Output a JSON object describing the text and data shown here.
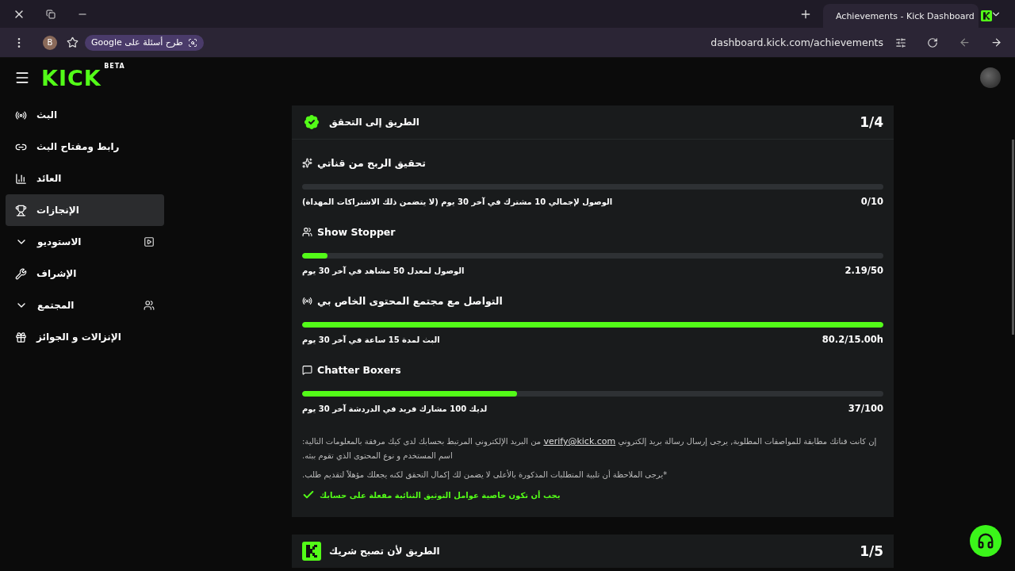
{
  "browser": {
    "tabs": [
      {
        "title": "Achievements - Kick Dashboard",
        "selected": true
      }
    ],
    "profile": "B",
    "search_chip": "طرح أسئلة على Google",
    "address": "dashboard.kick.com/achievements"
  },
  "header": {
    "logo": "KICK",
    "badge": "BETA"
  },
  "sidebar": {
    "items": [
      {
        "label": "البث",
        "kind": "link",
        "selected": false
      },
      {
        "label": "رابط ومفتاح البث",
        "kind": "link",
        "selected": false
      },
      {
        "label": "العائد",
        "kind": "link",
        "selected": false
      },
      {
        "label": "الإنجازات",
        "kind": "link",
        "selected": true
      },
      {
        "label": "الاستوديو",
        "kind": "group",
        "selected": false,
        "expanded": false
      },
      {
        "label": "الإشراف",
        "kind": "link",
        "selected": false
      },
      {
        "label": "المجتمع",
        "kind": "group",
        "selected": false,
        "expanded": false
      },
      {
        "label": "الإنزالات و الجوائز",
        "kind": "link",
        "selected": false
      }
    ]
  },
  "cards": [
    {
      "title": "الطريق إلى التحقق",
      "progress": "1/4",
      "expanded": true,
      "requirements": [
        {
          "title": "تحقيق الربح من قناتي",
          "description": "الوصول لإجمالي 10 مشترك في آخر 30 يوم (لا يتضمن ذلك الاشتراكات المهداة)",
          "reading": "0/10",
          "level": 0
        },
        {
          "title": "Show Stopper",
          "description": "الوصول لمعدل 50 مشاهد في آخر 30 يوم",
          "reading": "2.19/50",
          "level": 0.044
        },
        {
          "title": "التواصل مع مجتمع المحتوى الخاص بي",
          "description": "البث لمدة 15 ساعة في آخر 30 يوم",
          "reading": "80.2/15.00h",
          "level": 1
        },
        {
          "title": "Chatter Boxers",
          "description": "لديك 100 مشارك فريد في الدردشة آخر 30 يوم",
          "reading": "37/100",
          "level": 0.37
        }
      ],
      "note": {
        "before": "إن كانت قناتك مطابقة للمواصفات المطلوبة, يرجى إرسال رسالة بريد إلكتروني",
        "link": "verify@kick.com",
        "after": "من البريد الإلكتروني المرتبط بحسابك لدى كيك مرفقة بالمعلومات التالية: اسم المستخدم و نوع المحتوى الذي تقوم ببثه."
      },
      "disclaimer": "*يرجى الملاحظة أن تلبية المتطلبات المذكورة بالأعلى لا يضمن لك إكمال التحقق لكنه يجعلك مؤهلاً لتقديم طلب.",
      "checks": [
        {
          "label": "يجب أن تكون خاصية عوامل التوثيق الثنائية مفعلة على حسابك",
          "met": true
        }
      ]
    },
    {
      "title": "الطريق لأن تصبح شريك",
      "progress": "1/5",
      "expanded": false
    }
  ]
}
